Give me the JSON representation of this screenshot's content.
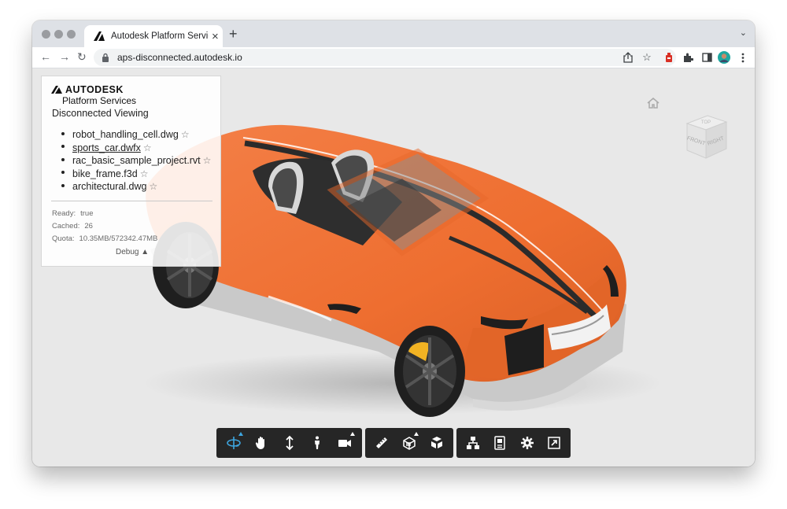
{
  "browser": {
    "tab_title": "Autodesk Platform Services: D",
    "tab_close": "×",
    "new_tab": "+",
    "tab_menu": "⌄",
    "url": "aps-disconnected.autodesk.io",
    "back": "←",
    "forward": "→",
    "reload": "↻"
  },
  "panel": {
    "brand_name": "AUTODESK",
    "brand_sub": "Platform Services",
    "heading": "Disconnected Viewing",
    "models": [
      {
        "name": "robot_handling_cell.dwg",
        "star": "☆"
      },
      {
        "name": "sports_car.dwfx",
        "star": "☆",
        "active": true
      },
      {
        "name": "rac_basic_sample_project.rvt",
        "star": "☆"
      },
      {
        "name": "bike_frame.f3d",
        "star": "☆"
      },
      {
        "name": "architectural.dwg",
        "star": "☆"
      }
    ],
    "stats": {
      "ready_label": "Ready:",
      "ready_value": "true",
      "cached_label": "Cached:",
      "cached_value": "26",
      "quota_label": "Quota:",
      "quota_value": "10.35MB/572342.47MB"
    },
    "debug_label": "Debug ▲"
  },
  "viewcube": {
    "front": "FRONT",
    "right": "RIGHT",
    "top": "TOP"
  },
  "toolbar_groups": [
    [
      "orbit-icon",
      "pan-icon",
      "dolly-icon",
      "first-person-icon",
      "camera-icon"
    ],
    [
      "measure-icon",
      "section-icon",
      "explode-icon"
    ],
    [
      "model-browser-icon",
      "properties-icon",
      "settings-icon",
      "fullscreen-icon"
    ]
  ],
  "colors": {
    "car_body": "#ee7034",
    "toolbar_bg": "#262626",
    "active_tool": "#3ea6e0"
  }
}
